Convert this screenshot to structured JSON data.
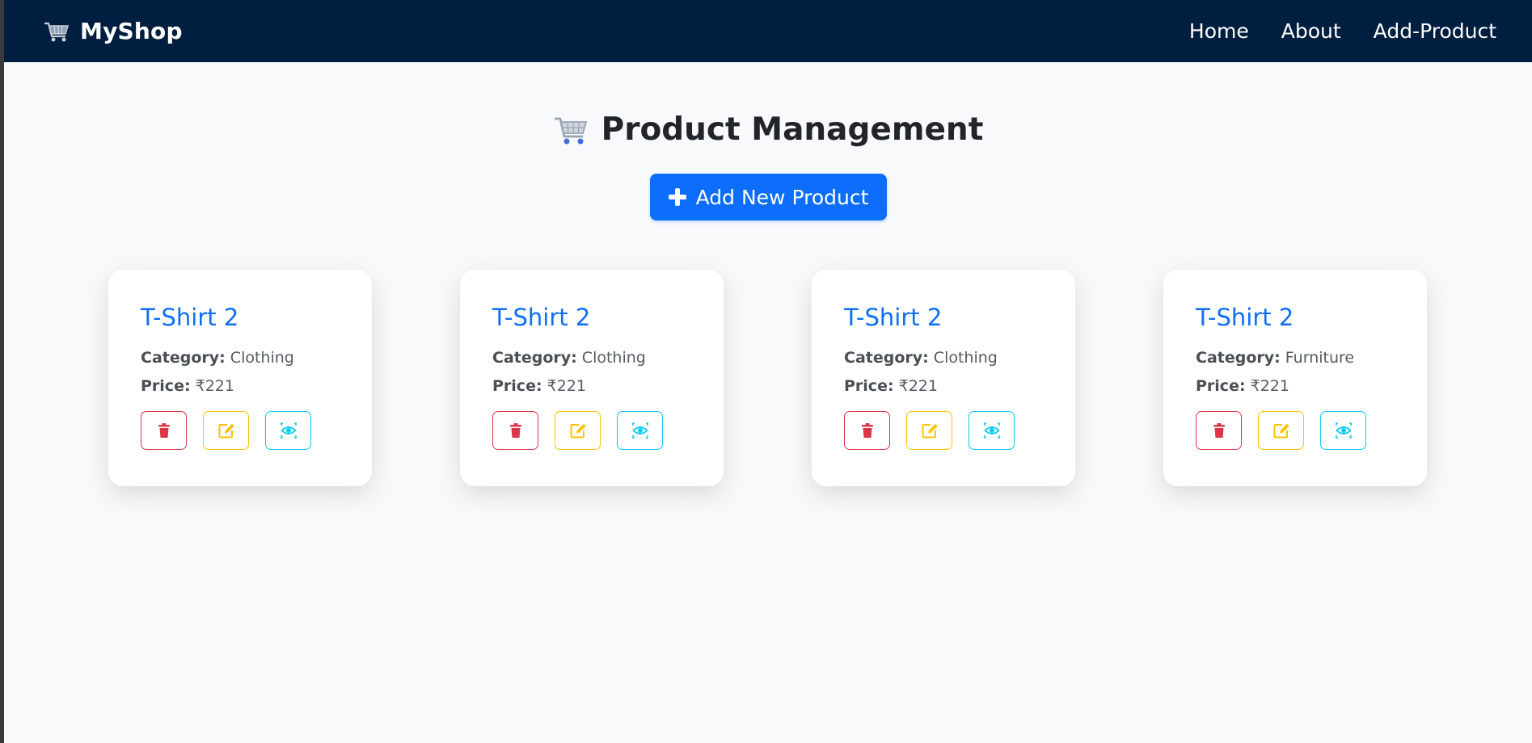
{
  "navbar": {
    "brand_icon": "shopping-cart-icon",
    "brand": "MyShop",
    "links": [
      "Home",
      "About",
      "Add-Product"
    ]
  },
  "main": {
    "title_icon": "shopping-cart-icon",
    "title": "Product Management",
    "add_button": "Add New Product",
    "add_button_icon": "plus-icon"
  },
  "labels": {
    "category": "Category:",
    "price": "Price:"
  },
  "products": [
    {
      "name": "T-Shirt 2",
      "category": "Clothing",
      "price": "₹221"
    },
    {
      "name": "T-Shirt 2",
      "category": "Clothing",
      "price": "₹221"
    },
    {
      "name": "T-Shirt 2",
      "category": "Clothing",
      "price": "₹221"
    },
    {
      "name": "T-Shirt 2",
      "category": "Furniture",
      "price": "₹221"
    }
  ],
  "card_actions": [
    "trash-icon",
    "edit-icon",
    "eye-icon"
  ],
  "colors": {
    "navbar_bg": "#001e3f",
    "primary": "#0d6efd",
    "danger": "#dc3545",
    "warning": "#ffc107",
    "info": "#0dcaf0",
    "page_bg": "#f8f9fa"
  }
}
